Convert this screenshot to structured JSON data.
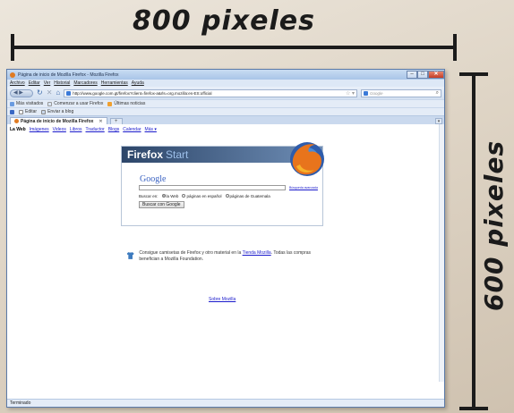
{
  "annotations": {
    "width_label": "800 pixeles",
    "height_label": "600 pixeles"
  },
  "window": {
    "title": "Página de inicio de Mozilla Firefox - Mozilla Firefox",
    "controls": [
      "–",
      "□",
      "✕"
    ]
  },
  "menu": [
    "Archivo",
    "Editar",
    "Ver",
    "Historial",
    "Marcadores",
    "Herramientas",
    "Ayuda"
  ],
  "navbar": {
    "url": "http://www.google.com.gt/firefox?client=firefox-a&rls=org.mozilla:es-ES:official",
    "search_placeholder": "Google"
  },
  "bookmarks": [
    "Más visitados",
    "Comenzar a usar Firefox",
    "Últimas noticias"
  ],
  "toolbar2": [
    "Editar",
    "Enviar a blog"
  ],
  "tabs": [
    {
      "label": "Página de inicio de Mozilla Firefox",
      "active": true
    }
  ],
  "google_nav": {
    "current": "La Web",
    "links": [
      "Imágenes",
      "Videos",
      "Libros",
      "Traductor",
      "Blogs",
      "Calendar",
      "Más ▾"
    ]
  },
  "firefox_start": {
    "brand": "Firefox",
    "start": "Start",
    "google_logo": "Google",
    "advanced_link": "Búsqueda avanzada",
    "search_in_label": "Buscar en:",
    "radio_options": [
      "la Web",
      "páginas en español",
      "páginas de Guatemala"
    ],
    "search_button": "Buscar con Google"
  },
  "promo": {
    "text_before": "Consigue camisetas de Firefox y otro material en la",
    "link": "Tienda Mozilla",
    "text_after": ". Todas las compras benefician a Mozilla Foundation."
  },
  "about_link": "Sobre Mozilla",
  "status": "Terminado",
  "colors": {
    "titlebar": "#a9c5e8",
    "firefox_header": "#2d4669",
    "link": "#1a1acc"
  }
}
